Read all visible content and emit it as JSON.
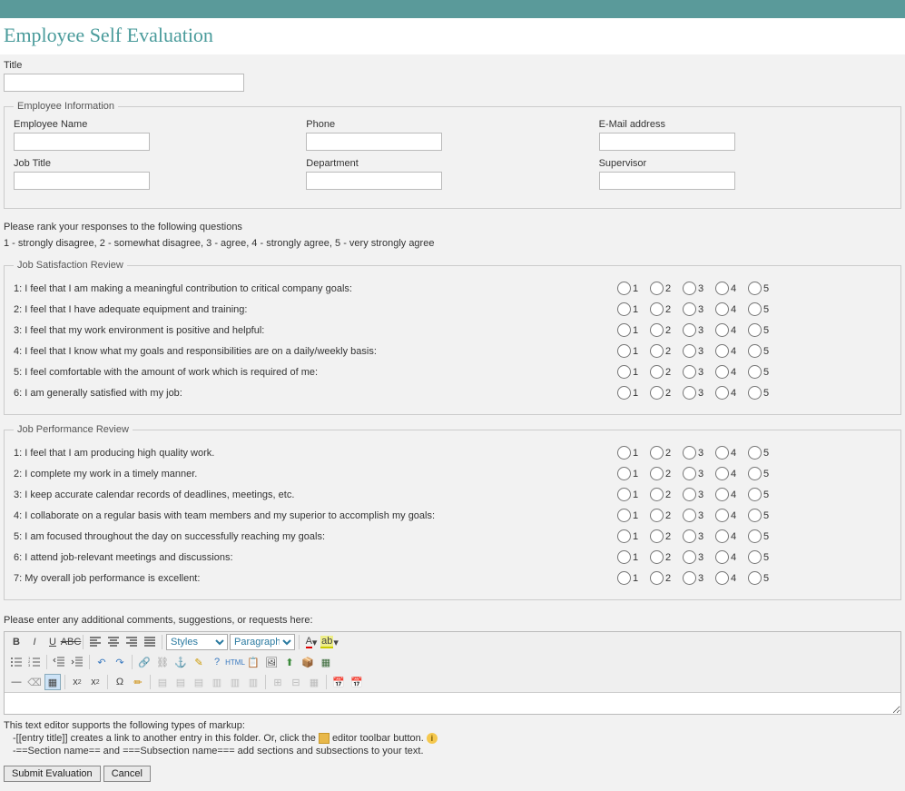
{
  "header": {
    "page_title": "Employee Self Evaluation"
  },
  "title_field": {
    "label": "Title",
    "value": ""
  },
  "employee_info": {
    "legend": "Employee Information",
    "fields": {
      "name": {
        "label": "Employee Name",
        "value": ""
      },
      "phone": {
        "label": "Phone",
        "value": ""
      },
      "email": {
        "label": "E-Mail address",
        "value": ""
      },
      "jobtitle": {
        "label": "Job Title",
        "value": ""
      },
      "dept": {
        "label": "Department",
        "value": ""
      },
      "supervisor": {
        "label": "Supervisor",
        "value": ""
      }
    }
  },
  "instructions": {
    "rank": "Please rank your responses to the following questions",
    "scale": "1 - strongly disagree, 2 - somewhat disagree, 3 - agree, 4 - strongly agree, 5 - very strongly agree"
  },
  "scale_options": [
    "1",
    "2",
    "3",
    "4",
    "5"
  ],
  "satisfaction": {
    "legend": "Job Satisfaction Review",
    "questions": [
      "1: I feel that I am making a meaningful contribution to critical company goals:",
      "2: I feel that I have adequate equipment and training:",
      "3: I feel that my work environment is positive and helpful:",
      "4: I feel that I know what my goals and responsibilities are on a daily/weekly basis:",
      "5: I feel comfortable with the amount of work which is required of me:",
      "6: I am generally satisfied with my job:"
    ]
  },
  "performance": {
    "legend": "Job Performance Review",
    "questions": [
      "1: I feel that I am producing high quality work.",
      "2: I complete my work in a timely manner.",
      "3: I keep accurate calendar records of deadlines, meetings, etc.",
      "4: I collaborate on a regular basis with team members and my superior to accomplish my goals:",
      "5: I am focused throughout the day on successfully reaching my goals:",
      "6: I attend job-relevant meetings and discussions:",
      "7: My overall job performance is excellent:"
    ]
  },
  "comments": {
    "instruction": "Please enter any additional comments, suggestions, or requests here:",
    "styles_label": "Styles",
    "paragraph_label": "Paragraph",
    "value": ""
  },
  "markup_help": {
    "title": "This text editor supports the following types of markup:",
    "line1_a": "-[[entry title]] creates a link to another entry in this folder. Or, click the ",
    "line1_b": " editor toolbar button. ",
    "line2": "-==Section name== and ===Subsection name=== add sections and subsections to your text."
  },
  "buttons": {
    "submit": "Submit Evaluation",
    "cancel": "Cancel"
  }
}
